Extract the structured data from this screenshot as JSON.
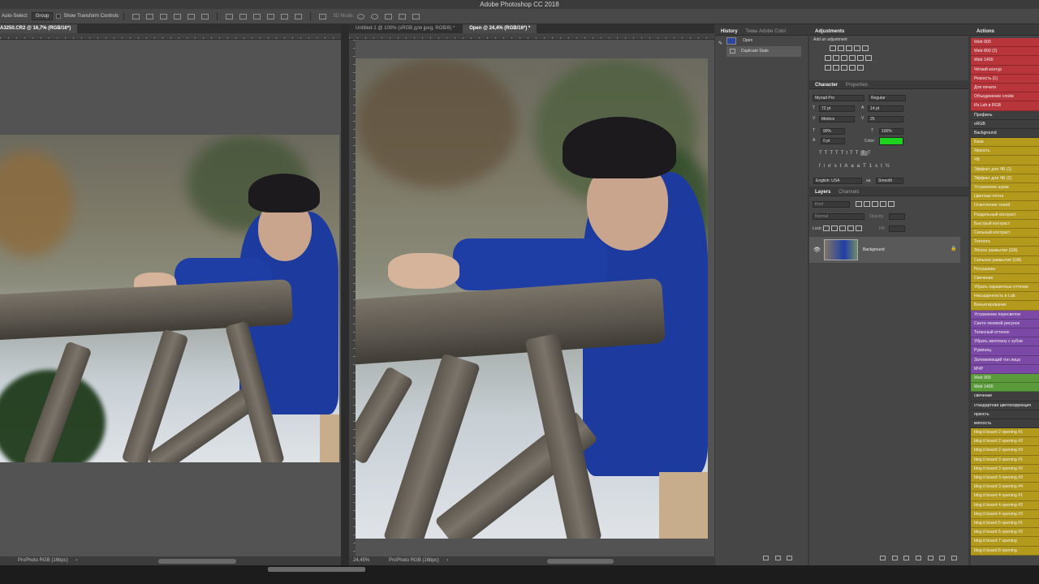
{
  "app": {
    "title": "Adobe Photoshop CC 2018"
  },
  "options_bar": {
    "auto_select_label": "Auto-Select:",
    "auto_select_value": "Group",
    "show_transform_label": "Show Transform Controls",
    "mode_3d_label": "3D Mode:"
  },
  "left_doc": {
    "tab_label": "A3250.CR2 @ 16,7% (RGB/16*)",
    "status_profile": "ProPhoto RGB (16bpc)"
  },
  "right_doc": {
    "tabs": [
      {
        "label": "Untitled-1 @ 100% (sRGB для jpeg, RGB/8) *",
        "active": false
      },
      {
        "label": "Open @ 24,4% (RGB/16*) *",
        "active": true
      }
    ],
    "status_zoom": "24,45%",
    "status_profile": "ProPhoto RGB (16bpc)"
  },
  "history_panel": {
    "tabs": [
      "History",
      "Темы Adobe Color"
    ],
    "items": [
      {
        "label": "Open"
      },
      {
        "label": "Duplicate State"
      }
    ]
  },
  "adjustments_panel": {
    "title": "Adjustments",
    "subtitle": "Add an adjustment"
  },
  "character_panel": {
    "tabs": [
      "Character",
      "Properties"
    ],
    "font_family": "Myriad Pro",
    "font_style": "Regular",
    "font_size": "72 pt",
    "leading": "14 pt",
    "kerning": "Metrics",
    "tracking": "25",
    "vertical_scale": "90%",
    "horizontal_scale": "100%",
    "baseline_shift": "0 pt",
    "color_label": "Color:",
    "color_value": "#1ed31e",
    "language": "English: USA",
    "antialias": "Smooth"
  },
  "layers_panel": {
    "tabs": [
      "Layers",
      "Channels"
    ],
    "filter_label": "Kind",
    "blend_mode": "Normal",
    "opacity_label": "Opacity:",
    "lock_label": "Lock:",
    "fill_label": "Fill:",
    "layers": [
      {
        "name": "Background"
      }
    ]
  },
  "actions_panel": {
    "title": "Actions",
    "items": [
      {
        "label": "Web 900",
        "color": "#b8353b"
      },
      {
        "label": "Web 800 (2)",
        "color": "#b8353b"
      },
      {
        "label": "Web 1400",
        "color": "#b8353b"
      },
      {
        "label": "Чёткий контур",
        "color": "#b8353b"
      },
      {
        "label": "Резкость (1)",
        "color": "#b8353b"
      },
      {
        "label": "Для печати",
        "color": "#b8353b"
      },
      {
        "label": "Объединение слоёв",
        "color": "#b8353b"
      },
      {
        "label": "Из Lab в RGB",
        "color": "#b8353b"
      },
      {
        "label": "Профиль",
        "color": "#3e3e3e"
      },
      {
        "label": "sRGB",
        "color": "#3e3e3e"
      },
      {
        "label": "Background",
        "color": "#3e3e3e"
      },
      {
        "label": "База",
        "color": "#b39a1c"
      },
      {
        "label": "Яркость",
        "color": "#b39a1c"
      },
      {
        "label": "ЧБ",
        "color": "#b39a1c"
      },
      {
        "label": "Эффект для ЧБ (1)",
        "color": "#b39a1c"
      },
      {
        "label": "Эффект для ЧБ (2)",
        "color": "#b39a1c"
      },
      {
        "label": "Устранение шума",
        "color": "#b39a1c"
      },
      {
        "label": "Цветные пятна",
        "color": "#b39a1c"
      },
      {
        "label": "Осветление теней",
        "color": "#b39a1c"
      },
      {
        "label": "Раздельный контраст",
        "color": "#b39a1c"
      },
      {
        "label": "Быстрый контраст",
        "color": "#b39a1c"
      },
      {
        "label": "Сильный контраст",
        "color": "#b39a1c"
      },
      {
        "label": "Теплота",
        "color": "#b39a1c"
      },
      {
        "label": "Лёгкое размытие (GB)",
        "color": "#b39a1c"
      },
      {
        "label": "Сильное размытие (GB)",
        "color": "#b39a1c"
      },
      {
        "label": "Ретушевка",
        "color": "#b39a1c"
      },
      {
        "label": "Свечение",
        "color": "#b39a1c"
      },
      {
        "label": "Убрать паразитные оттенки",
        "color": "#b39a1c"
      },
      {
        "label": "Насыщенность в Lab",
        "color": "#b39a1c"
      },
      {
        "label": "Виньетирование",
        "color": "#b39a1c"
      },
      {
        "label": "Устранение пересветов",
        "color": "#7c4aa6"
      },
      {
        "label": "Свето-теневой рисунок",
        "color": "#7c4aa6"
      },
      {
        "label": "Телесный оттенок",
        "color": "#7c4aa6"
      },
      {
        "label": "Убрать желтизну с зубов",
        "color": "#7c4aa6"
      },
      {
        "label": "Румянец",
        "color": "#7c4aa6"
      },
      {
        "label": "Затемняющий тон лица",
        "color": "#7c4aa6"
      },
      {
        "label": "МЧР",
        "color": "#7c4aa6"
      },
      {
        "label": "Web 900",
        "color": "#5b9a3a"
      },
      {
        "label": "Web 1400",
        "color": "#5b9a3a"
      },
      {
        "label": "свечение",
        "color": "#3e3e3e"
      },
      {
        "label": "стандартная цветокоррекция",
        "color": "#3e3e3e"
      },
      {
        "label": "яркость",
        "color": "#3e3e3e"
      },
      {
        "label": "мягкость",
        "color": "#3e3e3e"
      },
      {
        "label": "blog it board 2 opening #1",
        "color": "#b39a1c"
      },
      {
        "label": "blog it board 2 opening #2",
        "color": "#b39a1c"
      },
      {
        "label": "blog it board 2 opening #3",
        "color": "#b39a1c"
      },
      {
        "label": "blog it board 3 opening #1",
        "color": "#b39a1c"
      },
      {
        "label": "blog it board 3 opening #2",
        "color": "#b39a1c"
      },
      {
        "label": "blog it board 3 opening #3",
        "color": "#b39a1c"
      },
      {
        "label": "blog it board 3 opening #4",
        "color": "#b39a1c"
      },
      {
        "label": "blog it board 4 opening #1",
        "color": "#b39a1c"
      },
      {
        "label": "blog it board 4 opening #2",
        "color": "#b39a1c"
      },
      {
        "label": "blog it board 4 opening #3",
        "color": "#b39a1c"
      },
      {
        "label": "blog it board 5 opening #1",
        "color": "#b39a1c"
      },
      {
        "label": "blog it board 5 opening #2",
        "color": "#b39a1c"
      },
      {
        "label": "blog it board 7 opening",
        "color": "#b39a1c"
      },
      {
        "label": "blog it board 8 opening",
        "color": "#b39a1c"
      }
    ]
  }
}
